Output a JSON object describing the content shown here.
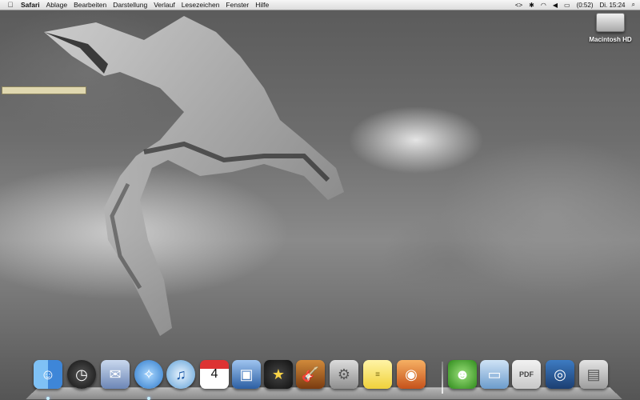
{
  "menubar": {
    "apple_menu": "",
    "app_name": "Safari",
    "menus": [
      "Ablage",
      "Bearbeiten",
      "Darstellung",
      "Verlauf",
      "Lesezeichen",
      "Fenster",
      "Hilfe"
    ],
    "status": {
      "script_menu": "<>",
      "battery_time": "(0:52)",
      "clock": "Di. 15:24"
    }
  },
  "desktop": {
    "hd_label": "Macintosh HD",
    "progress_fraction": 1.0
  },
  "dock": {
    "items": [
      {
        "icon": "finder-icon"
      },
      {
        "icon": "dashboard-icon"
      },
      {
        "icon": "mail-icon"
      },
      {
        "icon": "safari-icon"
      },
      {
        "icon": "itunes-icon"
      },
      {
        "icon": "ical-icon",
        "text": "4"
      },
      {
        "icon": "iphoto-icon"
      },
      {
        "icon": "imovie-icon"
      },
      {
        "icon": "garageband-icon"
      },
      {
        "icon": "system-preferences-icon"
      },
      {
        "icon": "stickies-icon"
      },
      {
        "icon": "image-capture-icon"
      },
      {
        "icon": "adium-icon"
      },
      {
        "icon": "folder-icon"
      },
      {
        "icon": "documents-stack-icon",
        "text": "PDF"
      },
      {
        "icon": "network-icon"
      },
      {
        "icon": "trash-icon"
      }
    ]
  },
  "colors": {
    "menubar": "#e8e8e8",
    "wallpaper": "#6e6e6e",
    "progress": "#e0d8b0"
  }
}
